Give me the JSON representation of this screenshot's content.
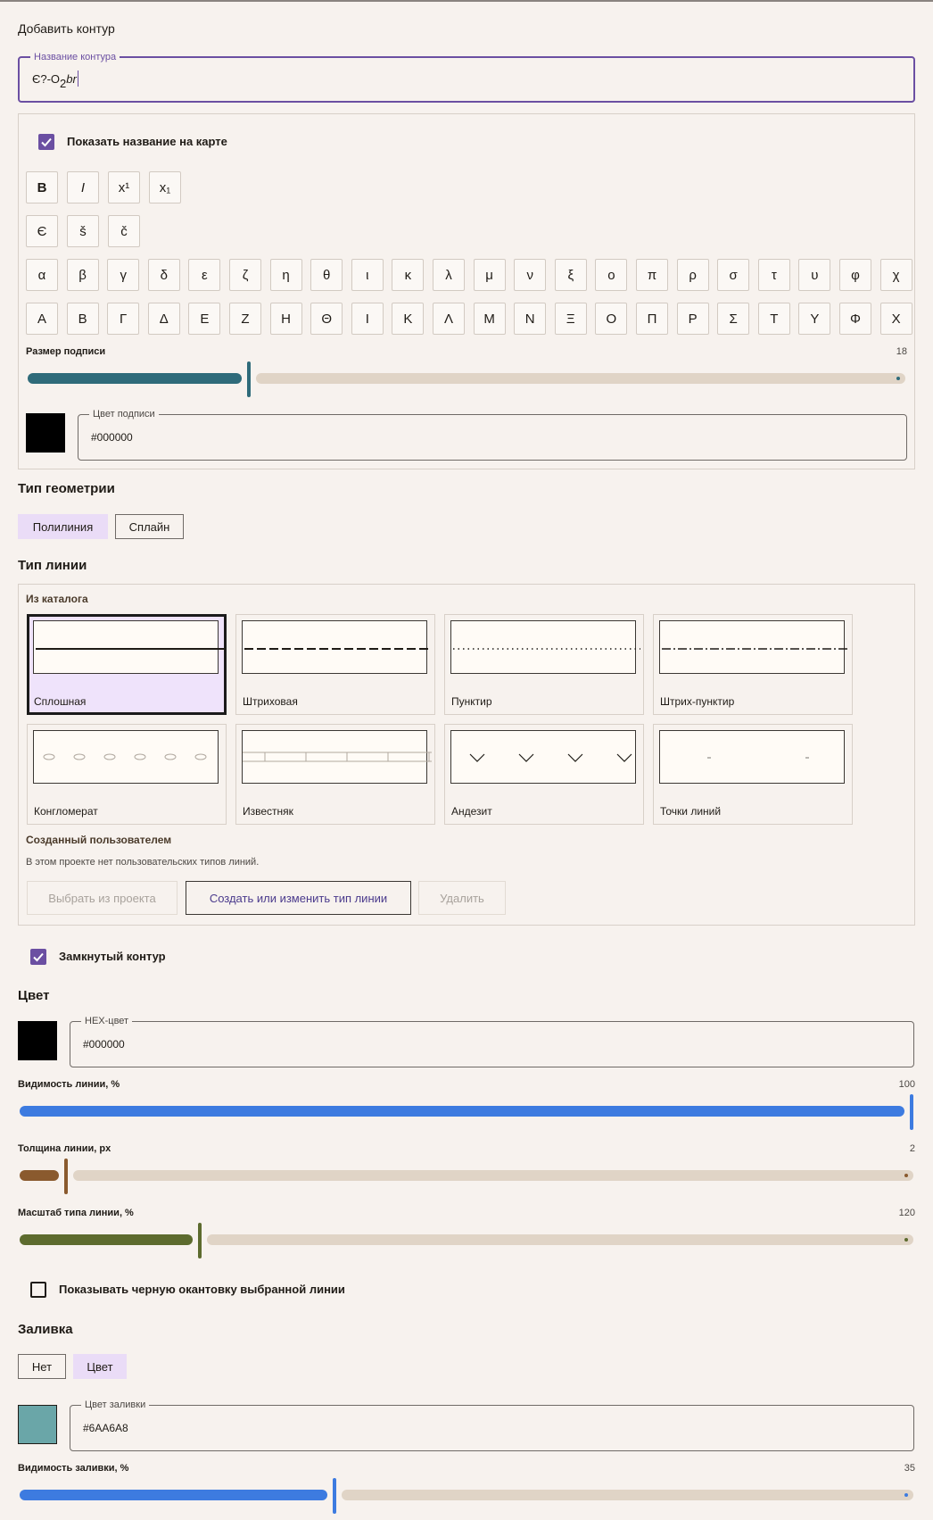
{
  "title": "Добавить контур",
  "name_field": {
    "label": "Название контура",
    "value_prefix": "Є?-O",
    "value_sub": "2",
    "value_suffix": "br"
  },
  "show_label": {
    "checked": true,
    "label": "Показать название на карте"
  },
  "format_buttons": [
    "B",
    "I",
    "x¹",
    "x₁"
  ],
  "special_chars": [
    "Є",
    "š",
    "č"
  ],
  "greek_lower": [
    "α",
    "β",
    "γ",
    "δ",
    "ε",
    "ζ",
    "η",
    "θ",
    "ι",
    "κ",
    "λ",
    "μ",
    "ν",
    "ξ",
    "ο",
    "π",
    "ρ",
    "σ",
    "τ",
    "υ",
    "φ",
    "χ"
  ],
  "greek_upper": [
    "Α",
    "Β",
    "Γ",
    "Δ",
    "Ε",
    "Ζ",
    "Η",
    "Θ",
    "Ι",
    "Κ",
    "Λ",
    "Μ",
    "Ν",
    "Ξ",
    "Ο",
    "Π",
    "Ρ",
    "Σ",
    "Τ",
    "Υ",
    "Φ",
    "Χ"
  ],
  "label_size": {
    "label": "Размер подписи",
    "value": "18",
    "fraction": 0.25
  },
  "label_color": {
    "label": "Цвет подписи",
    "value": "#000000"
  },
  "geometry": {
    "title": "Тип геометрии",
    "options": [
      "Полилиния",
      "Сплайн"
    ],
    "selected": "Полилиния"
  },
  "line_type": {
    "title": "Тип линии",
    "catalog_title": "Из каталога",
    "cards": [
      {
        "name": "Сплошная",
        "pattern": "solid",
        "selected": true
      },
      {
        "name": "Штриховая",
        "pattern": "dashed",
        "selected": false
      },
      {
        "name": "Пунктир",
        "pattern": "dotted",
        "selected": false
      },
      {
        "name": "Штрих-пунктир",
        "pattern": "dashdot",
        "selected": false
      },
      {
        "name": "Конгломерат",
        "pattern": "ovals",
        "selected": false
      },
      {
        "name": "Известняк",
        "pattern": "limestone",
        "selected": false
      },
      {
        "name": "Андезит",
        "pattern": "chevrons",
        "selected": false
      },
      {
        "name": "Точки линий",
        "pattern": "points",
        "selected": false
      }
    ],
    "custom_title": "Созданный пользователем",
    "custom_empty": "В этом проекте нет пользовательских типов линий.",
    "buttons": {
      "pick": "Выбрать из проекта",
      "create": "Создать или изменить тип линии",
      "delete": "Удалить"
    }
  },
  "closed": {
    "checked": true,
    "label": "Замкнутый контур"
  },
  "color": {
    "title": "Цвет",
    "label": "HEX-цвет",
    "value": "#000000"
  },
  "line_visibility": {
    "label": "Видимость линии, %",
    "value": "100",
    "fraction": 1.0
  },
  "line_width": {
    "label": "Толщина линии, px",
    "value": "2",
    "fraction": 0.05
  },
  "line_scale": {
    "label": "Масштаб типа линии, %",
    "value": "120",
    "fraction": 0.2
  },
  "black_outline": {
    "checked": false,
    "label": "Показывать черную окантовку выбранной линии"
  },
  "fill": {
    "title": "Заливка",
    "options": [
      "Нет",
      "Цвет"
    ],
    "selected": "Цвет",
    "label": "Цвет заливки",
    "value": "#6AA6A8"
  },
  "fill_visibility": {
    "label": "Видимость заливки, %",
    "value": "35",
    "fraction": 0.35
  },
  "colors": {
    "accent": "#6b4fa2",
    "teal": "#2f6b7a",
    "blue": "#3d7be0",
    "brown": "#8a5a2e",
    "olive": "#5d6b2e",
    "fill": "#6AA6A8"
  }
}
